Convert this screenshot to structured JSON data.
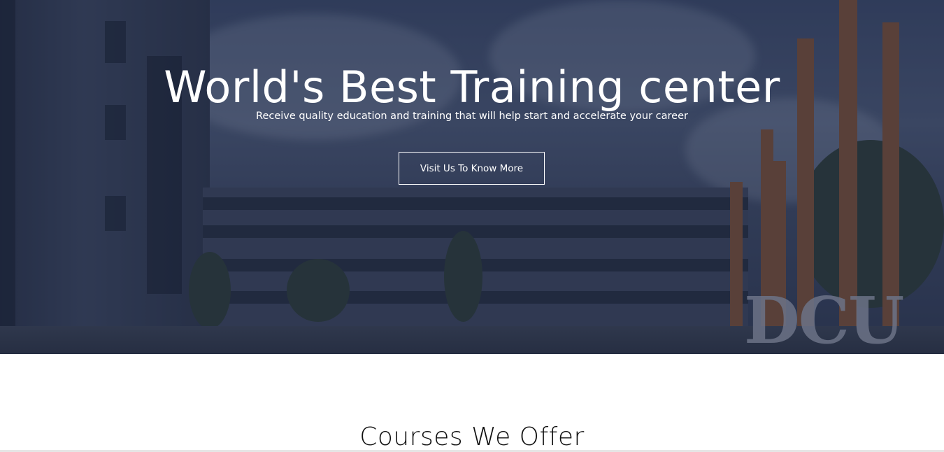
{
  "hero": {
    "title": "World's Best Training center",
    "subtitle": "Receive quality education and training that will help start and accelerate your career",
    "cta_label": "Visit Us To Know More",
    "sign_text": "DCU"
  },
  "courses": {
    "title": "Courses We Offer"
  }
}
